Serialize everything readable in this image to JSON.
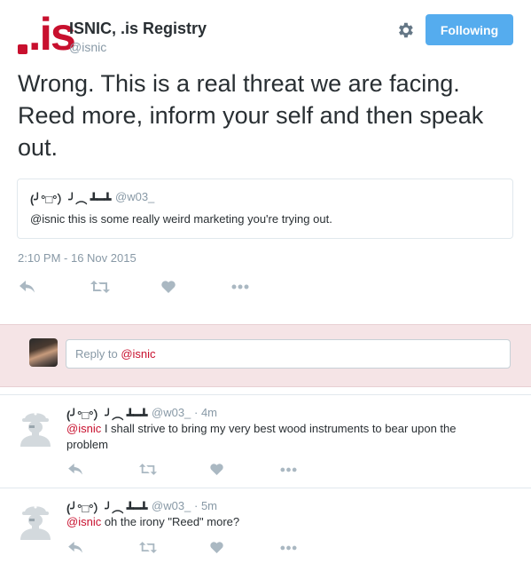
{
  "header": {
    "logo_text": ".is",
    "account_name": "ISNIC, .is Registry",
    "account_handle": "@isnic",
    "follow_label": "Following"
  },
  "tweet": {
    "text": "Wrong. This is a real threat we are facing. Reed more, inform your self and then speak out.",
    "timestamp": "2:10 PM - 16 Nov 2015"
  },
  "quote": {
    "name": "(╯°□°）╯︵ ┻━┻",
    "handle": "@w03_",
    "text": "@isnic this is some really weird marketing you're trying out."
  },
  "reply_box": {
    "prefix": "Reply to ",
    "mention": "@isnic"
  },
  "replies": [
    {
      "name": "(╯°□°）╯︵ ┻━┻",
      "handle": "@w03_",
      "time": "· 4m",
      "mention": "@isnic",
      "text": " I shall strive to bring my very best wood instruments to bear upon the problem"
    },
    {
      "name": "(╯°□°）╯︵ ┻━┻",
      "handle": "@w03_",
      "time": "· 5m",
      "mention": "@isnic",
      "text": " oh the irony \"Reed\" more?"
    }
  ],
  "icons": {
    "reply": "reply-icon",
    "retweet": "retweet-icon",
    "like": "heart-icon",
    "more": "more-icon",
    "settings": "gear-icon",
    "default_avatar": "pirate-avatar-icon"
  },
  "colors": {
    "brand_red": "#c8102e",
    "follow_blue": "#55acee",
    "reply_bg": "#f5e4e6",
    "icon_gray": "#aab8c2"
  }
}
